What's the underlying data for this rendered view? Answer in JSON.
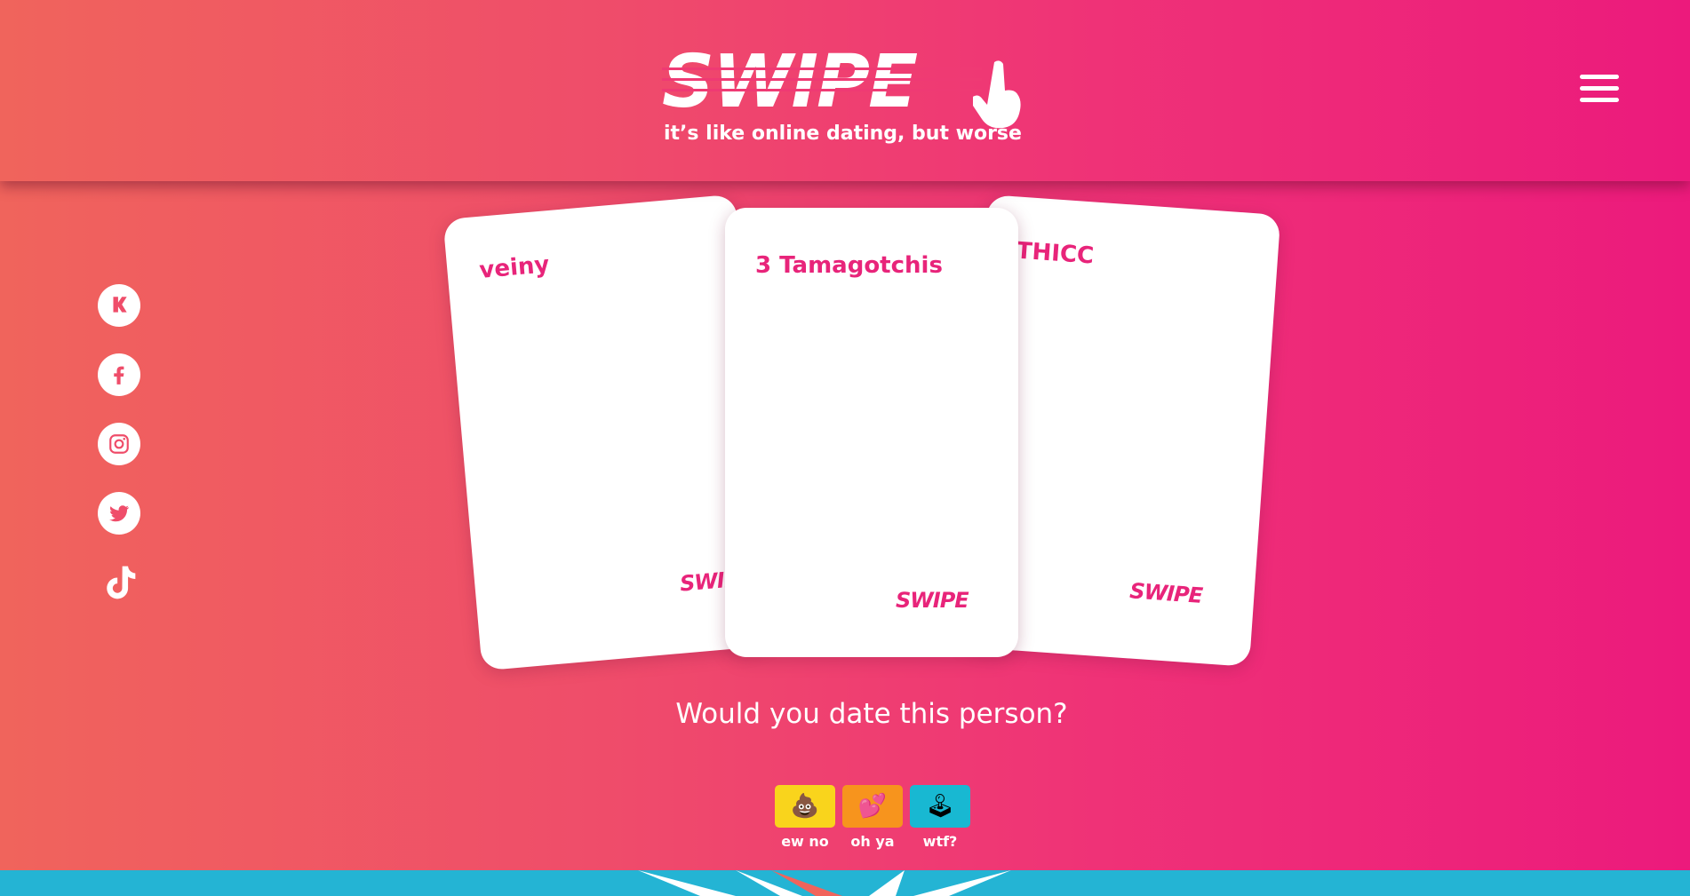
{
  "header": {
    "logo_text": "SWIPE",
    "tagline": "it’s like online dating, but worse",
    "menu_icon": "hamburger-menu-icon"
  },
  "social_links": [
    {
      "name": "kickstarter",
      "icon": "kickstarter-icon"
    },
    {
      "name": "facebook",
      "icon": "facebook-icon"
    },
    {
      "name": "instagram",
      "icon": "instagram-icon"
    },
    {
      "name": "twitter",
      "icon": "twitter-icon"
    },
    {
      "name": "tiktok",
      "icon": "tiktok-icon"
    }
  ],
  "cards": [
    {
      "text": "veiny",
      "brand": "SWIPE"
    },
    {
      "text": "3 Tamagotchis",
      "brand": "SWIPE"
    },
    {
      "text": "THICC",
      "brand": "SWIPE"
    }
  ],
  "question": "Would you date this person?",
  "votes": [
    {
      "label": "ew no",
      "icon": "poop-emoji",
      "emoji": "💩",
      "color": "#f9d41c"
    },
    {
      "label": "oh ya",
      "icon": "hearts-emoji",
      "emoji": "💕",
      "color": "#f7941d"
    },
    {
      "label": "wtf?",
      "icon": "joystick-emoji",
      "emoji": "🕹",
      "color": "#18b8d2"
    }
  ],
  "colors": {
    "gradient_start": "#f0645c",
    "gradient_end": "#ec1a7c",
    "card_text": "#e8247a",
    "footer_band": "#24b4d4"
  }
}
